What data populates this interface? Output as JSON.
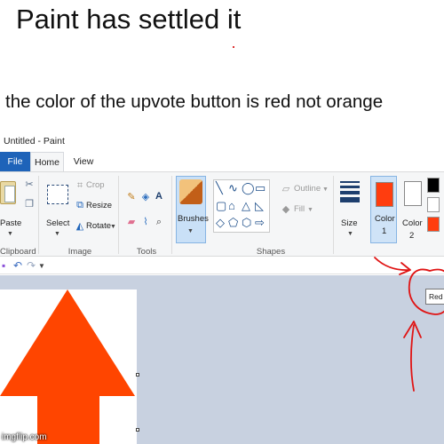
{
  "meme": {
    "title": "Paint has settled it",
    "caption": "the color of the upvote button is red not orange",
    "watermark": "imgflip.com"
  },
  "window": {
    "title": "Untitled - Paint"
  },
  "tabs": {
    "file": "File",
    "home": "Home",
    "view": "View"
  },
  "clipboard": {
    "paste": "Paste",
    "group": "Clipboard"
  },
  "image": {
    "select": "Select",
    "crop": "Crop",
    "resize": "Resize",
    "rotate": "Rotate",
    "group": "Image"
  },
  "tools": {
    "group": "Tools"
  },
  "brushes": {
    "label": "Brushes"
  },
  "shapes": {
    "outline": "Outline",
    "fill": "Fill",
    "group": "Shapes"
  },
  "size": {
    "label": "Size"
  },
  "colors": {
    "color1_label": "Color",
    "color1_num": "1",
    "color2_label": "Color",
    "color2_num": "2",
    "color1_value": "#ff3d0f",
    "palette": [
      "#000000",
      "#7f7f7f",
      "#ffffff",
      "#c3c3c3",
      "#ff3d0f",
      "#ffffff"
    ]
  },
  "tooltip": {
    "text": "Red"
  },
  "canvas": {
    "arrow_color": "#ff4500"
  },
  "annotation": {
    "ink_color": "#e01414"
  }
}
